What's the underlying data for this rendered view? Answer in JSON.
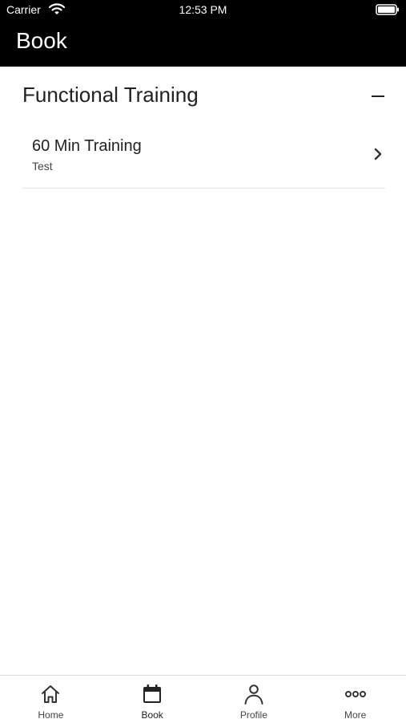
{
  "status_bar": {
    "carrier": "Carrier",
    "time": "12:53 PM"
  },
  "header": {
    "title": "Book"
  },
  "section": {
    "title": "Functional Training",
    "expanded": true,
    "items": [
      {
        "title": "60 Min Training",
        "subtitle": "Test"
      }
    ]
  },
  "tab_bar": {
    "active": "Book",
    "tabs": [
      {
        "label": "Home",
        "icon": "home-icon"
      },
      {
        "label": "Book",
        "icon": "calendar-icon"
      },
      {
        "label": "Profile",
        "icon": "person-icon"
      },
      {
        "label": "More",
        "icon": "more-icon"
      }
    ]
  },
  "colors": {
    "header_background": "#000000",
    "header_text": "#ffffff",
    "body_text": "#222222"
  }
}
